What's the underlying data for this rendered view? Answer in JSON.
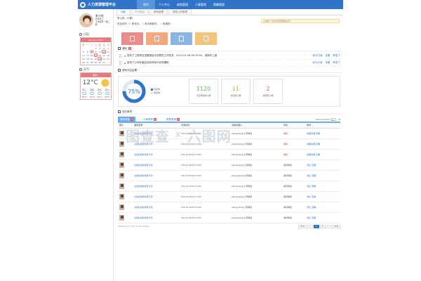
{
  "app": {
    "logo_text": "人力资源管理平台"
  },
  "nav": [
    "首页",
    "个人中心",
    "绩效管理",
    "人事管理",
    "薪酬管理"
  ],
  "sidebar": {
    "user_name": "李小明",
    "user_role": "普通员工",
    "user_dept": "工作编号一楼三期",
    "calendar_title": "日历",
    "calendar_head": "January 2014",
    "calendar_days": [
      "日",
      "一",
      "二",
      "三",
      "四",
      "五",
      "六"
    ],
    "calendar_dates": [
      "",
      "",
      "",
      "1",
      "2",
      "3",
      "4",
      "5",
      "6",
      "7",
      "8",
      "9",
      "10",
      "11",
      "12",
      "13",
      "14",
      "15",
      "16",
      "17",
      "18",
      "19",
      "20",
      "21",
      "22",
      "23",
      "24",
      "25",
      "26",
      "27",
      "28",
      "29",
      "30",
      "31",
      ""
    ],
    "weather_title": "天气",
    "weather_head": "星期二",
    "temp": "12°C",
    "forecast": [
      {
        "d": "周三",
        "t": "16°C"
      },
      {
        "d": "周四",
        "t": "15°C"
      },
      {
        "d": "周五",
        "t": "16°C"
      },
      {
        "d": "周六",
        "t": "16°C"
      }
    ]
  },
  "tabs": [
    "功能",
    "个人中心",
    "绩效管理",
    "绩效计划管理"
  ],
  "welcome": {
    "greeting": "李上好，小慧!",
    "summary_prefix": "您目前有",
    "count1": "15",
    "count1_text": "条待办",
    "count2": "1",
    "count2_text": "条未删邮件，",
    "count3": "2",
    "count3_text": "条通知!",
    "notice": "公告栏一点点点击查看信息行"
  },
  "quick_colors": [
    "#e98b8b",
    "#f2a97f",
    "#8ab5e4",
    "#f3c37b"
  ],
  "announcements": {
    "title": "通知",
    "count": "2",
    "items": [
      {
        "d1": "20",
        "d2": "12",
        "text": "发布了工程项目进展报告计划表的工作任务，2014-02-06 09:15:00，请按时上报",
        "a": "标为已读",
        "b": "查看",
        "c": "转发了"
      },
      {
        "d1": "20",
        "d2": "12",
        "text": "发布了公司年度会议的时间与安排通知",
        "a": "标为已读",
        "b": "查看",
        "c": "转发了"
      }
    ]
  },
  "stats": {
    "title": "绩效评估结果",
    "percent": "75%",
    "legend1": "已完成",
    "legend2": "未完成",
    "boxes": [
      {
        "v": "1120",
        "l": "已完成绩效人数",
        "c": "#6cb46c"
      },
      {
        "v": "11",
        "l": "未完成人数",
        "c": "#f2a23a"
      },
      {
        "v": "2",
        "l": "待审核人数",
        "c": "#e5595e"
      }
    ]
  },
  "tasks": {
    "title": "待办事项",
    "tabs": [
      {
        "l": "绩效考核",
        "c": "3"
      },
      {
        "l": "人事考核",
        "c": "2"
      },
      {
        "l": "考勤申请",
        "c": "1"
      }
    ],
    "show_label": "Show entries",
    "show_value": "10",
    "headers": [
      "照片",
      "事项名称",
      "创建时间",
      "当前处理人",
      "状态",
      "操作"
    ],
    "rows": [
      {
        "name": "[绩效]绩效考核计划",
        "time": "Feb 12,2013 14:20",
        "who": "wangxiang/公司审批",
        "status": "审批",
        "a": "提醒办理",
        "b": "查看"
      },
      {
        "name": "[绩效]绩效考核计划",
        "time": "Feb 12,2013 14:20",
        "who": "wangxiang/公司审批",
        "status": "审批",
        "a": "提醒办理",
        "b": "查看"
      },
      {
        "name": "[绩效]绩效考核计划",
        "time": "Feb 12,2013 14:20",
        "who": "wangxiang/公司审批",
        "status": "审批",
        "a": "提醒办理",
        "b": "查看"
      },
      {
        "name": "[绩效]绩效考核计划",
        "time": "Feb 12,2013 14:20",
        "who": "wangxiang/公司审批",
        "status": "等待审批",
        "a": "通过",
        "b": "查看"
      },
      {
        "name": "[绩效]绩效考核计划",
        "time": "Feb 12,2013 14:20",
        "who": "wangxiang/公司审批",
        "status": "等待审批",
        "a": "通过",
        "b": "查看"
      },
      {
        "name": "[绩效]绩效考核计划",
        "time": "Feb 12,2013 14:20",
        "who": "wangxiang/公司审批",
        "status": "等待审批",
        "a": "通过",
        "b": "查看"
      },
      {
        "name": "[绩效]绩效考核计划",
        "time": "Feb 12,2013 14:20",
        "who": "wangxiang/公司审批",
        "status": "等待审批",
        "a": "通过",
        "b": "查看"
      },
      {
        "name": "[绩效]绩效考核计划",
        "time": "Feb 12,2013 14:20",
        "who": "wangxiang/公司审批",
        "status": "等待审批",
        "a": "通过",
        "b": "查看"
      },
      {
        "name": "[绩效]绩效考核计划",
        "time": "Feb 12,2013 14:20",
        "who": "wangxiang/公司审批",
        "status": "等待审批",
        "a": "通过",
        "b": "查看"
      }
    ],
    "footer": "Showing 1 to 10 of 12 entries",
    "pager": [
      "First",
      "‹",
      "1",
      "2",
      "›",
      "Last"
    ]
  },
  "watermark": {
    "left": "图查查",
    "x": "X",
    "right": "六图网"
  }
}
